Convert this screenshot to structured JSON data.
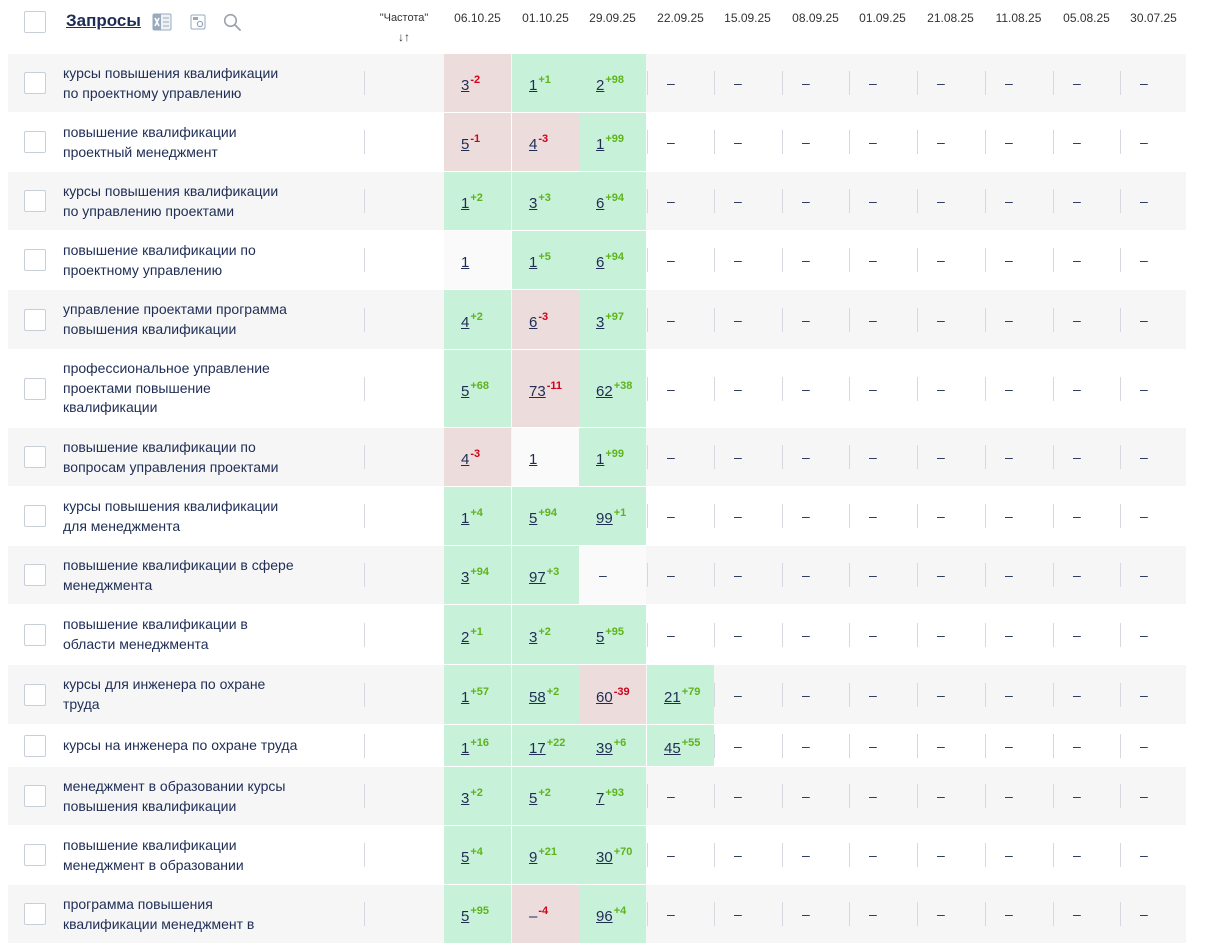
{
  "header": {
    "title": "Запросы",
    "frequency_label": "\"Частота\"",
    "frequency_sort": "↓↑",
    "dates": [
      "06.10.25",
      "01.10.25",
      "29.09.25",
      "22.09.25",
      "15.09.25",
      "08.09.25",
      "01.09.25",
      "21.08.25",
      "11.08.25",
      "05.08.25",
      "30.07.25"
    ]
  },
  "rows": [
    {
      "text": [
        "курсы повышения квалификации",
        "по проектному управлению"
      ],
      "cells": [
        {
          "v": "3",
          "d": "-2",
          "bg": "down"
        },
        {
          "v": "1",
          "d": "+1",
          "bg": "up"
        },
        {
          "v": "2",
          "d": "+98",
          "bg": "up"
        },
        {
          "v": "–"
        },
        {
          "v": "–"
        },
        {
          "v": "–"
        },
        {
          "v": "–"
        },
        {
          "v": "–"
        },
        {
          "v": "–"
        },
        {
          "v": "–"
        },
        {
          "v": "–"
        }
      ]
    },
    {
      "text": [
        "повышение квалификации",
        "проектный менеджмент"
      ],
      "cells": [
        {
          "v": "5",
          "d": "-1",
          "bg": "down"
        },
        {
          "v": "4",
          "d": "-3",
          "bg": "down"
        },
        {
          "v": "1",
          "d": "+99",
          "bg": "up"
        },
        {
          "v": "–"
        },
        {
          "v": "–"
        },
        {
          "v": "–"
        },
        {
          "v": "–"
        },
        {
          "v": "–"
        },
        {
          "v": "–"
        },
        {
          "v": "–"
        },
        {
          "v": "–"
        }
      ]
    },
    {
      "text": [
        "курсы повышения квалификации",
        "по управлению проектами"
      ],
      "cells": [
        {
          "v": "1",
          "d": "+2",
          "bg": "up"
        },
        {
          "v": "3",
          "d": "+3",
          "bg": "up"
        },
        {
          "v": "6",
          "d": "+94",
          "bg": "up"
        },
        {
          "v": "–"
        },
        {
          "v": "–"
        },
        {
          "v": "–"
        },
        {
          "v": "–"
        },
        {
          "v": "–"
        },
        {
          "v": "–"
        },
        {
          "v": "–"
        },
        {
          "v": "–"
        }
      ]
    },
    {
      "text": [
        "повышение квалификации по",
        "проектному управлению"
      ],
      "cells": [
        {
          "v": "1",
          "d": "",
          "bg": "neutral"
        },
        {
          "v": "1",
          "d": "+5",
          "bg": "up"
        },
        {
          "v": "6",
          "d": "+94",
          "bg": "up"
        },
        {
          "v": "–"
        },
        {
          "v": "–"
        },
        {
          "v": "–"
        },
        {
          "v": "–"
        },
        {
          "v": "–"
        },
        {
          "v": "–"
        },
        {
          "v": "–"
        },
        {
          "v": "–"
        }
      ]
    },
    {
      "text": [
        "управление проектами программа",
        "повышения квалификации"
      ],
      "cells": [
        {
          "v": "4",
          "d": "+2",
          "bg": "up"
        },
        {
          "v": "6",
          "d": "-3",
          "bg": "down"
        },
        {
          "v": "3",
          "d": "+97",
          "bg": "up"
        },
        {
          "v": "–"
        },
        {
          "v": "–"
        },
        {
          "v": "–"
        },
        {
          "v": "–"
        },
        {
          "v": "–"
        },
        {
          "v": "–"
        },
        {
          "v": "–"
        },
        {
          "v": "–"
        }
      ]
    },
    {
      "text": [
        "профессиональное управление",
        "проектами повышение",
        "квалификации"
      ],
      "cells": [
        {
          "v": "5",
          "d": "+68",
          "bg": "up"
        },
        {
          "v": "73",
          "d": "-11",
          "bg": "down"
        },
        {
          "v": "62",
          "d": "+38",
          "bg": "up"
        },
        {
          "v": "–"
        },
        {
          "v": "–"
        },
        {
          "v": "–"
        },
        {
          "v": "–"
        },
        {
          "v": "–"
        },
        {
          "v": "–"
        },
        {
          "v": "–"
        },
        {
          "v": "–"
        }
      ]
    },
    {
      "text": [
        "повышение квалификации по",
        "вопросам управления проектами"
      ],
      "cells": [
        {
          "v": "4",
          "d": "-3",
          "bg": "down"
        },
        {
          "v": "1",
          "d": "",
          "bg": "neutral"
        },
        {
          "v": "1",
          "d": "+99",
          "bg": "up"
        },
        {
          "v": "–"
        },
        {
          "v": "–"
        },
        {
          "v": "–"
        },
        {
          "v": "–"
        },
        {
          "v": "–"
        },
        {
          "v": "–"
        },
        {
          "v": "–"
        },
        {
          "v": "–"
        }
      ]
    },
    {
      "text": [
        "курсы повышения квалификации",
        "для менеджмента"
      ],
      "cells": [
        {
          "v": "1",
          "d": "+4",
          "bg": "up"
        },
        {
          "v": "5",
          "d": "+94",
          "bg": "up"
        },
        {
          "v": "99",
          "d": "+1",
          "bg": "up"
        },
        {
          "v": "–"
        },
        {
          "v": "–"
        },
        {
          "v": "–"
        },
        {
          "v": "–"
        },
        {
          "v": "–"
        },
        {
          "v": "–"
        },
        {
          "v": "–"
        },
        {
          "v": "–"
        }
      ]
    },
    {
      "text": [
        "повышение квалификации в сфере",
        "менеджмента"
      ],
      "cells": [
        {
          "v": "3",
          "d": "+94",
          "bg": "up"
        },
        {
          "v": "97",
          "d": "+3",
          "bg": "up"
        },
        {
          "v": "–",
          "bg": "neutral"
        },
        {
          "v": "–"
        },
        {
          "v": "–"
        },
        {
          "v": "–"
        },
        {
          "v": "–"
        },
        {
          "v": "–"
        },
        {
          "v": "–"
        },
        {
          "v": "–"
        },
        {
          "v": "–"
        }
      ]
    },
    {
      "text": [
        "повышение квалификации в",
        "области менеджмента"
      ],
      "cells": [
        {
          "v": "2",
          "d": "+1",
          "bg": "up"
        },
        {
          "v": "3",
          "d": "+2",
          "bg": "up"
        },
        {
          "v": "5",
          "d": "+95",
          "bg": "up"
        },
        {
          "v": "–"
        },
        {
          "v": "–"
        },
        {
          "v": "–"
        },
        {
          "v": "–"
        },
        {
          "v": "–"
        },
        {
          "v": "–"
        },
        {
          "v": "–"
        },
        {
          "v": "–"
        }
      ]
    },
    {
      "text": [
        "курсы для инженера по охране",
        "труда"
      ],
      "cells": [
        {
          "v": "1",
          "d": "+57",
          "bg": "up"
        },
        {
          "v": "58",
          "d": "+2",
          "bg": "up"
        },
        {
          "v": "60",
          "d": "-39",
          "bg": "down"
        },
        {
          "v": "21",
          "d": "+79",
          "bg": "up"
        },
        {
          "v": "–"
        },
        {
          "v": "–"
        },
        {
          "v": "–"
        },
        {
          "v": "–"
        },
        {
          "v": "–"
        },
        {
          "v": "–"
        },
        {
          "v": "–"
        }
      ]
    },
    {
      "text": [
        "курсы на инженера по охране труда"
      ],
      "cells": [
        {
          "v": "1",
          "d": "+16",
          "bg": "up"
        },
        {
          "v": "17",
          "d": "+22",
          "bg": "up"
        },
        {
          "v": "39",
          "d": "+6",
          "bg": "up"
        },
        {
          "v": "45",
          "d": "+55",
          "bg": "up"
        },
        {
          "v": "–"
        },
        {
          "v": "–"
        },
        {
          "v": "–"
        },
        {
          "v": "–"
        },
        {
          "v": "–"
        },
        {
          "v": "–"
        },
        {
          "v": "–"
        }
      ]
    },
    {
      "text": [
        "менеджмент в образовании курсы",
        "повышения квалификации"
      ],
      "cells": [
        {
          "v": "3",
          "d": "+2",
          "bg": "up"
        },
        {
          "v": "5",
          "d": "+2",
          "bg": "up"
        },
        {
          "v": "7",
          "d": "+93",
          "bg": "up"
        },
        {
          "v": "–"
        },
        {
          "v": "–"
        },
        {
          "v": "–"
        },
        {
          "v": "–"
        },
        {
          "v": "–"
        },
        {
          "v": "–"
        },
        {
          "v": "–"
        },
        {
          "v": "–"
        }
      ]
    },
    {
      "text": [
        "повышение квалификации",
        "менеджмент в образовании"
      ],
      "cells": [
        {
          "v": "5",
          "d": "+4",
          "bg": "up"
        },
        {
          "v": "9",
          "d": "+21",
          "bg": "up"
        },
        {
          "v": "30",
          "d": "+70",
          "bg": "up"
        },
        {
          "v": "–"
        },
        {
          "v": "–"
        },
        {
          "v": "–"
        },
        {
          "v": "–"
        },
        {
          "v": "–"
        },
        {
          "v": "–"
        },
        {
          "v": "–"
        },
        {
          "v": "–"
        }
      ]
    },
    {
      "text": [
        "программа повышения",
        "квалификации менеджмент в"
      ],
      "cells": [
        {
          "v": "5",
          "d": "+95",
          "bg": "up"
        },
        {
          "v": "–",
          "d": "-4",
          "bg": "down"
        },
        {
          "v": "96",
          "d": "+4",
          "bg": "up"
        },
        {
          "v": "–"
        },
        {
          "v": "–"
        },
        {
          "v": "–"
        },
        {
          "v": "–"
        },
        {
          "v": "–"
        },
        {
          "v": "–"
        },
        {
          "v": "–"
        },
        {
          "v": "–"
        }
      ]
    }
  ]
}
